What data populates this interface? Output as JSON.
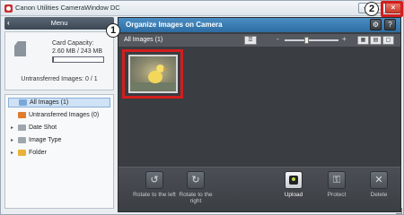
{
  "window": {
    "title": "Canon Utilities CameraWindow DC",
    "close_glyph": "×",
    "minimize_glyph": "–",
    "maximize_glyph": "□"
  },
  "callouts": {
    "one": "1",
    "two": "2"
  },
  "menu": {
    "back_glyph": "‹",
    "label": "Menu"
  },
  "card": {
    "capacity_label": "Card Capacity:",
    "capacity_value": "2.60 MB / 243 MB",
    "used_fraction": 0.011,
    "untransferred_label": "Untransferred Images: 0 / 1"
  },
  "tree": [
    {
      "label": "All Images (1)",
      "icon": "images-icon",
      "color": "#7aa7d8",
      "has_arrow": false,
      "selected": true
    },
    {
      "label": "Untransferred Images (0)",
      "icon": "untransferred-icon",
      "color": "#e07a2e",
      "has_arrow": false,
      "selected": false
    },
    {
      "label": "Date Shot",
      "icon": "calendar-icon",
      "color": "#9ea6ae",
      "has_arrow": true,
      "selected": false
    },
    {
      "label": "Image Type",
      "icon": "image-type-icon",
      "color": "#9ea6ae",
      "has_arrow": true,
      "selected": false
    },
    {
      "label": "Folder",
      "icon": "folder-icon",
      "color": "#e8b23a",
      "has_arrow": true,
      "selected": false
    }
  ],
  "main": {
    "title": "Organize Images on Camera",
    "settings_glyph": "⚙",
    "help_glyph": "?",
    "toolbar_label": "All Images (1)",
    "zoom_minus": "-",
    "zoom_plus": "+",
    "zoom_level": 0.4
  },
  "actions": [
    {
      "label": "Rotate to the left",
      "icon": "rotate-left-icon",
      "glyph": "↺",
      "enabled": false
    },
    {
      "label": "Rotate to the right",
      "icon": "rotate-right-icon",
      "glyph": "↻",
      "enabled": false
    },
    {
      "label": "Upload",
      "icon": "upload-icon",
      "glyph": "",
      "enabled": true
    },
    {
      "label": "Protect",
      "icon": "key-icon",
      "glyph": "⚿",
      "enabled": false
    },
    {
      "label": "Delete",
      "icon": "delete-icon",
      "glyph": "✕",
      "enabled": false
    }
  ]
}
